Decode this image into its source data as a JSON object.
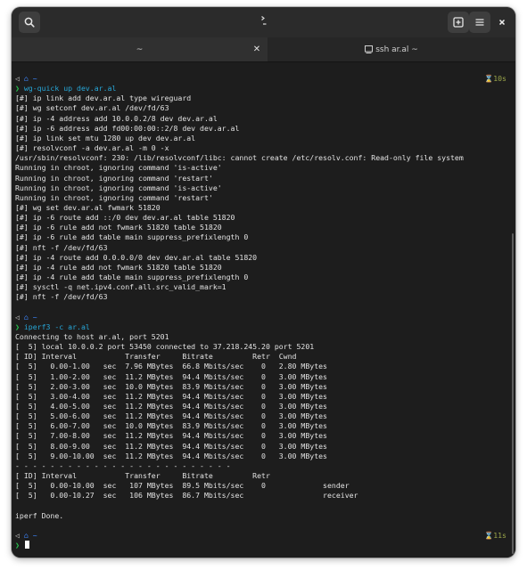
{
  "window": {
    "tabs": [
      {
        "label": "~"
      },
      {
        "label": "ssh ar.al ~"
      }
    ]
  },
  "icons": {
    "search": "search-icon",
    "title": "terminal-icon",
    "new_tab": "new-tab-icon",
    "menu": "hamburger-menu-icon",
    "close": "close-icon"
  },
  "colors": {
    "background": "#1d1d1d",
    "prompt_green": "#26c44d",
    "command_cyan": "#27a7d8",
    "home_blue": "#3d86ff",
    "duration": "#9aa54a"
  },
  "prompts": [
    {
      "home": "~",
      "command": "wg-quick up dev.ar.al",
      "duration": "10s"
    },
    {
      "home": "~",
      "command": "iperf3 -c ar.al",
      "duration": ""
    },
    {
      "home": "~",
      "command": "",
      "duration": "11s"
    }
  ],
  "output1": [
    "[#] ip link add dev.ar.al type wireguard",
    "[#] wg setconf dev.ar.al /dev/fd/63",
    "[#] ip -4 address add 10.0.0.2/8 dev dev.ar.al",
    "[#] ip -6 address add fd00:00:00::2/8 dev dev.ar.al",
    "[#] ip link set mtu 1280 up dev dev.ar.al",
    "[#] resolvconf -a dev.ar.al -m 0 -x",
    "/usr/sbin/resolvconf: 230: /lib/resolvconf/libc: cannot create /etc/resolv.conf: Read-only file system",
    "Running in chroot, ignoring command 'is-active'",
    "Running in chroot, ignoring command 'restart'",
    "Running in chroot, ignoring command 'is-active'",
    "Running in chroot, ignoring command 'restart'",
    "[#] wg set dev.ar.al fwmark 51820",
    "[#] ip -6 route add ::/0 dev dev.ar.al table 51820",
    "[#] ip -6 rule add not fwmark 51820 table 51820",
    "[#] ip -6 rule add table main suppress_prefixlength 0",
    "[#] nft -f /dev/fd/63",
    "[#] ip -4 route add 0.0.0.0/0 dev dev.ar.al table 51820",
    "[#] ip -4 rule add not fwmark 51820 table 51820",
    "[#] ip -4 rule add table main suppress_prefixlength 0",
    "[#] sysctl -q net.ipv4.conf.all.src_valid_mark=1",
    "[#] nft -f /dev/fd/63"
  ],
  "output2": [
    "Connecting to host ar.al, port 5201",
    "[  5] local 10.0.0.2 port 53450 connected to 37.218.245.20 port 5201",
    "[ ID] Interval           Transfer     Bitrate         Retr  Cwnd",
    "[  5]   0.00-1.00   sec  7.96 MBytes  66.8 Mbits/sec    0   2.80 MBytes",
    "[  5]   1.00-2.00   sec  11.2 MBytes  94.4 Mbits/sec    0   3.00 MBytes",
    "[  5]   2.00-3.00   sec  10.0 MBytes  83.9 Mbits/sec    0   3.00 MBytes",
    "[  5]   3.00-4.00   sec  11.2 MBytes  94.4 Mbits/sec    0   3.00 MBytes",
    "[  5]   4.00-5.00   sec  11.2 MBytes  94.4 Mbits/sec    0   3.00 MBytes",
    "[  5]   5.00-6.00   sec  11.2 MBytes  94.4 Mbits/sec    0   3.00 MBytes",
    "[  5]   6.00-7.00   sec  10.0 MBytes  83.9 Mbits/sec    0   3.00 MBytes",
    "[  5]   7.00-8.00   sec  11.2 MBytes  94.4 Mbits/sec    0   3.00 MBytes",
    "[  5]   8.00-9.00   sec  11.2 MBytes  94.4 Mbits/sec    0   3.00 MBytes",
    "[  5]   9.00-10.00  sec  11.2 MBytes  94.4 Mbits/sec    0   3.00 MBytes",
    "- - - - - - - - - - - - - - - - - - - - - - - - -",
    "[ ID] Interval           Transfer     Bitrate         Retr",
    "[  5]   0.00-10.00  sec   107 MBytes  89.5 Mbits/sec    0             sender",
    "[  5]   0.00-10.27  sec   106 MBytes  86.7 Mbits/sec                  receiver",
    "",
    "iperf Done."
  ]
}
